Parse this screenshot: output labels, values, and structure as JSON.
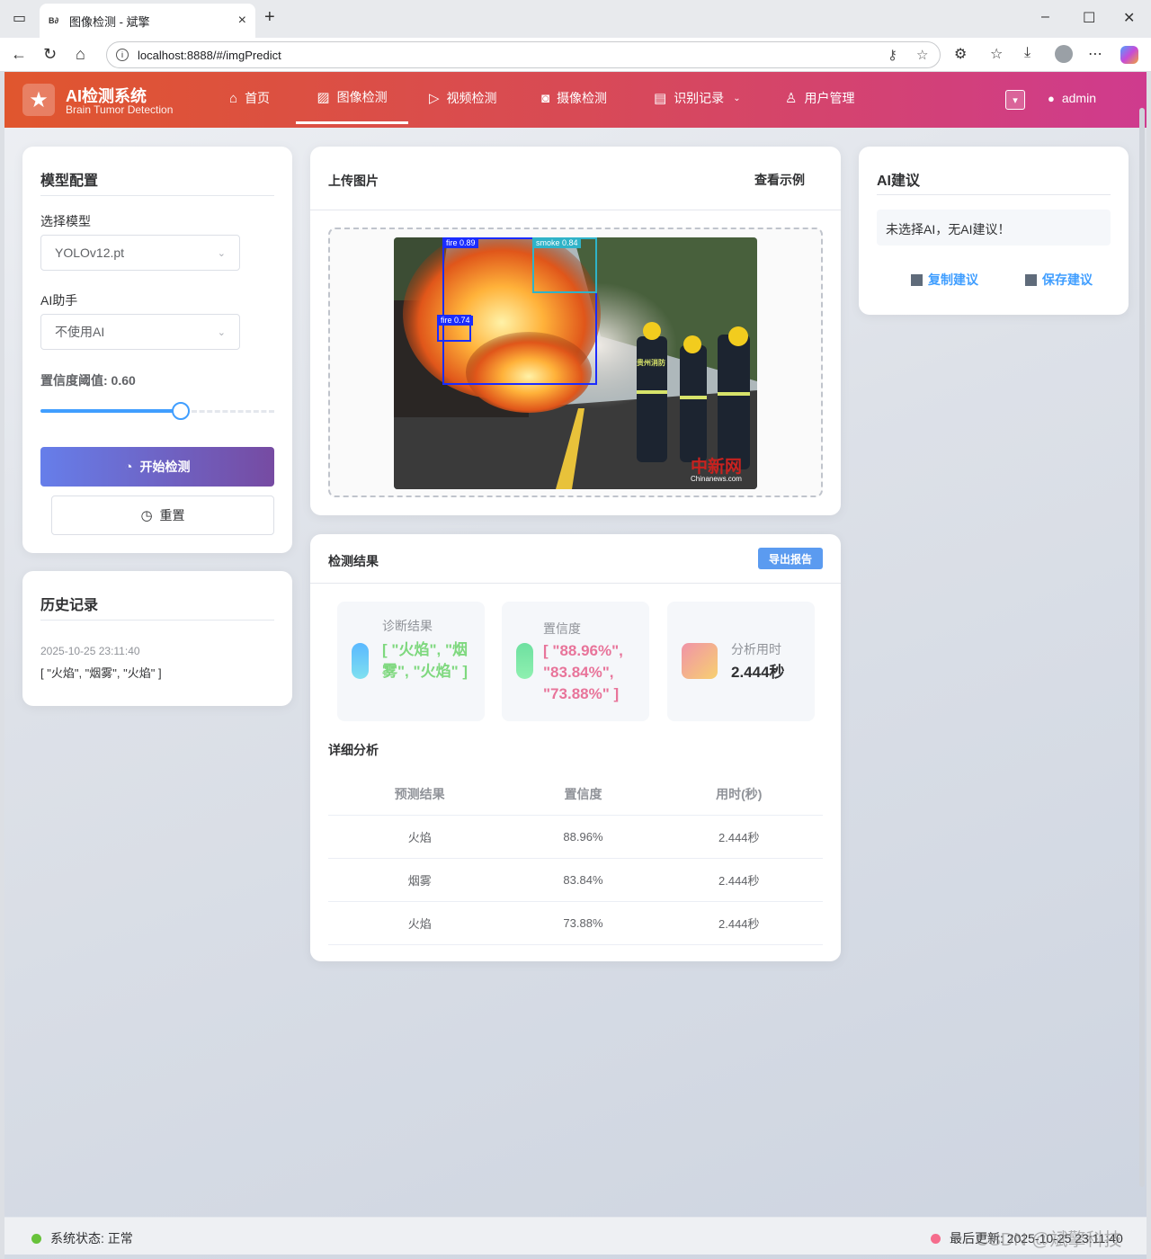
{
  "browser": {
    "tab_title": "图像检测 - 斌擎",
    "tab_favicon": "B∂",
    "url": "localhost:8888/#/imgPredict"
  },
  "header": {
    "title": "AI检测系统",
    "subtitle": "Brain Tumor Detection",
    "menu": [
      {
        "label": "首页",
        "icon": "home-icon"
      },
      {
        "label": "图像检测",
        "icon": "image-icon"
      },
      {
        "label": "视频检测",
        "icon": "play-circle-icon"
      },
      {
        "label": "摄像检测",
        "icon": "camera-icon"
      },
      {
        "label": "识别记录",
        "icon": "document-icon"
      },
      {
        "label": "用户管理",
        "icon": "user-icon"
      }
    ],
    "active_menu": "图像检测",
    "username": "admin",
    "gradient": [
      "#e0562e",
      "#cf3b8e"
    ]
  },
  "model_config": {
    "title": "模型配置",
    "model_label": "选择模型",
    "model_value": "YOLOv12.pt",
    "ai_label": "AI助手",
    "ai_value": "不使用AI",
    "threshold_label": "置信度阈值: 0.60",
    "threshold_value": 0.6,
    "start_button": "开始检测",
    "reset_button": "重置"
  },
  "history": {
    "title": "历史记录",
    "time": "2025-10-25 23:11:40",
    "result": "[ \"火焰\", \"烟雾\", \"火焰\" ]"
  },
  "upload": {
    "title": "上传图片",
    "example_link": "查看示例",
    "detections": [
      {
        "label": "fire  0.89",
        "color": "#1a2cff"
      },
      {
        "label": "smoke  0.84",
        "color": "#2fb3c8"
      },
      {
        "label": "fire  0.74",
        "color": "#1a2cff"
      }
    ],
    "watermark": "中新网",
    "watermark_sub": "Chinanews.com",
    "vest_text": "贵州消防"
  },
  "results": {
    "title": "检测结果",
    "export_button": "导出报告",
    "stats": [
      {
        "label": "诊断结果",
        "value": "[ \"火焰\", \"烟雾\", \"火焰\" ]",
        "color": "#7ed87e"
      },
      {
        "label": "置信度",
        "value": "[ \"88.96%\", \"83.84%\", \"73.88%\" ]",
        "color": "#e8749a"
      },
      {
        "label": "分析用时",
        "value": "2.444秒",
        "color": "#303133"
      }
    ],
    "detail_title": "详细分析",
    "columns": [
      "预测结果",
      "置信度",
      "用时(秒)"
    ],
    "rows": [
      [
        "火焰",
        "88.96%",
        "2.444秒"
      ],
      [
        "烟雾",
        "83.84%",
        "2.444秒"
      ],
      [
        "火焰",
        "73.88%",
        "2.444秒"
      ]
    ]
  },
  "ai_advice": {
    "title": "AI建议",
    "message": "未选择AI，无AI建议！",
    "copy_button": "复制建议",
    "save_button": "保存建议"
  },
  "footer": {
    "status": "系统状态: 正常",
    "last_update": "最后更新: 2025-10-25 23:11:40",
    "status_color": "#67c23a",
    "update_color": "#f56c8c",
    "watermark": "CSDN @斌擎科技"
  }
}
